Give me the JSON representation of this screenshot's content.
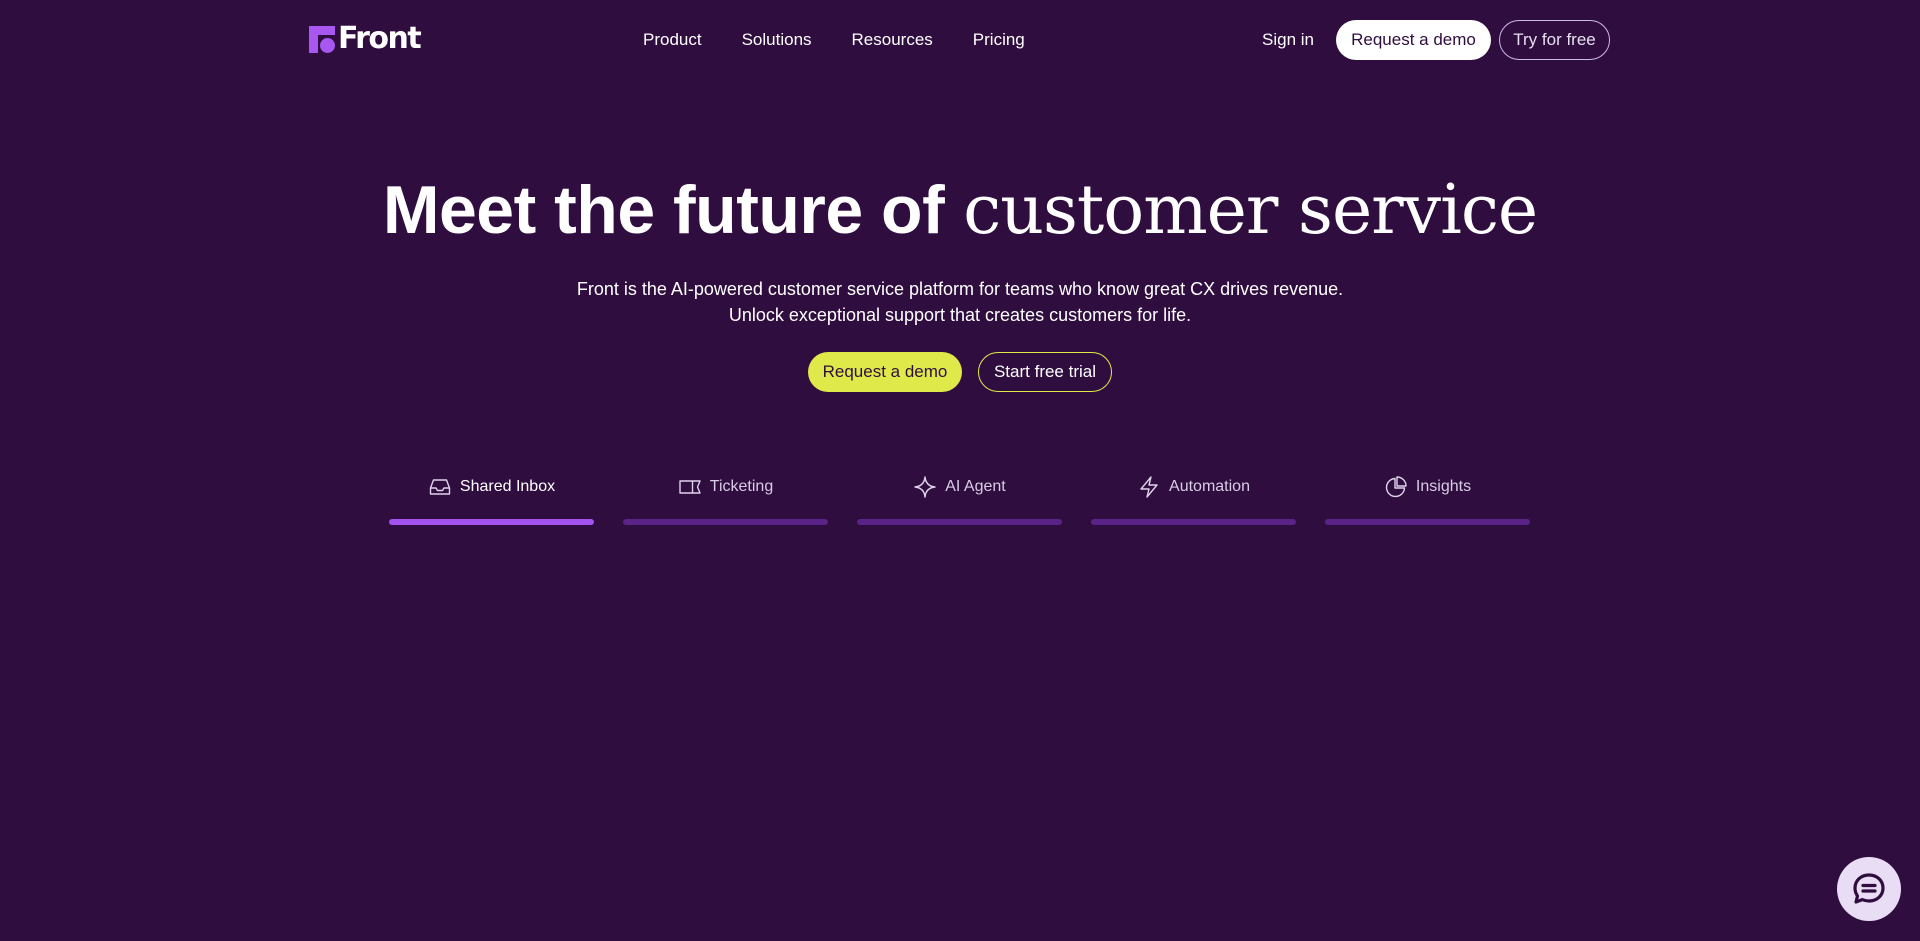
{
  "header": {
    "logo_text": "Front",
    "nav": [
      {
        "label": "Product"
      },
      {
        "label": "Solutions"
      },
      {
        "label": "Resources"
      },
      {
        "label": "Pricing"
      }
    ],
    "sign_in": "Sign in",
    "request_demo": "Request a demo",
    "try_free": "Try for free"
  },
  "hero": {
    "headline_sans": "Meet the future of",
    "headline_serif": "customer service",
    "subtitle_line1": "Front is the AI-powered customer service platform for teams who know great CX drives revenue.",
    "subtitle_line2": "Unlock exceptional support that creates customers for life.",
    "primary_cta": "Request a demo",
    "secondary_cta": "Start free trial"
  },
  "tabs": [
    {
      "label": "Shared Inbox",
      "icon": "inbox-icon",
      "active": true
    },
    {
      "label": "Ticketing",
      "icon": "ticket-icon",
      "active": false
    },
    {
      "label": "AI Agent",
      "icon": "sparkle-icon",
      "active": false
    },
    {
      "label": "Automation",
      "icon": "lightning-icon",
      "active": false
    },
    {
      "label": "Insights",
      "icon": "pie-chart-icon",
      "active": false
    }
  ],
  "chat_widget": {
    "icon": "chat-bubble-icon"
  },
  "colors": {
    "background": "#2f0d3e",
    "brand_purple": "#a857f0",
    "cta_yellow": "#dfea4a",
    "tab_active": "#a352f0",
    "tab_inactive": "#5a2388"
  }
}
